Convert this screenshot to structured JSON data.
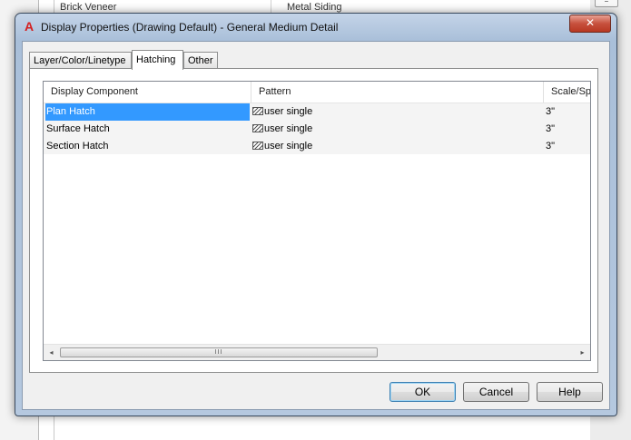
{
  "background": {
    "visible_rows": [
      "Brick Veneer",
      "Metal Siding"
    ]
  },
  "dialog": {
    "icon": "autocad-a-icon",
    "title": "Display Properties (Drawing Default) - General Medium Detail",
    "close_label": "✕"
  },
  "tabs": [
    {
      "label": "Layer/Color/Linetype",
      "active": false
    },
    {
      "label": "Hatching",
      "active": true
    },
    {
      "label": "Other",
      "active": false
    }
  ],
  "table": {
    "columns": [
      "Display Component",
      "Pattern",
      "Scale/Sp"
    ],
    "rows": [
      {
        "component": "Plan Hatch",
        "pattern": "user single",
        "scale": "3\"",
        "selected": true
      },
      {
        "component": "Surface Hatch",
        "pattern": "user single",
        "scale": "3\"",
        "selected": false
      },
      {
        "component": "Section Hatch",
        "pattern": "user single",
        "scale": "3\"",
        "selected": false
      }
    ],
    "scrollbar": {
      "left_arrow": "◂",
      "right_arrow": "▸",
      "grip": "III"
    }
  },
  "buttons": {
    "ok": "OK",
    "cancel": "Cancel",
    "help": "Help"
  },
  "colors": {
    "selection": "#3399ff",
    "app_icon": "#d42020",
    "close_button": "#c7513d"
  }
}
